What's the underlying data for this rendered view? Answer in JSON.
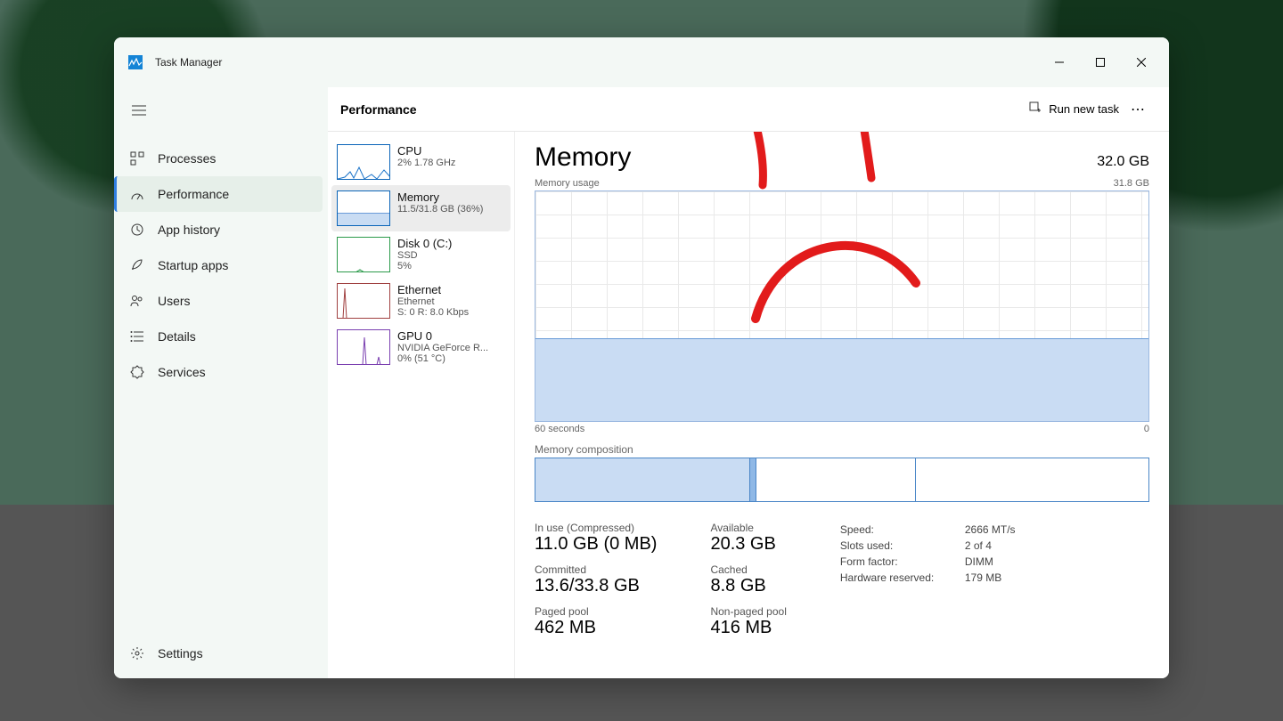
{
  "app": {
    "title": "Task Manager"
  },
  "win_buttons": {
    "min": "min",
    "max": "max",
    "close": "close"
  },
  "sidebar": {
    "items": [
      {
        "id": "processes",
        "label": "Processes"
      },
      {
        "id": "performance",
        "label": "Performance"
      },
      {
        "id": "apphistory",
        "label": "App history"
      },
      {
        "id": "startup",
        "label": "Startup apps"
      },
      {
        "id": "users",
        "label": "Users"
      },
      {
        "id": "details",
        "label": "Details"
      },
      {
        "id": "services",
        "label": "Services"
      }
    ],
    "settings_label": "Settings"
  },
  "header": {
    "title": "Performance",
    "run_task": "Run new task"
  },
  "perf_list": [
    {
      "name": "CPU",
      "sub": "2%  1.78 GHz"
    },
    {
      "name": "Memory",
      "sub": "11.5/31.8 GB (36%)"
    },
    {
      "name": "Disk 0 (C:)",
      "sub": "SSD",
      "sub2": "5%"
    },
    {
      "name": "Ethernet",
      "sub": "Ethernet",
      "sub2": "S: 0 R: 8.0 Kbps"
    },
    {
      "name": "GPU 0",
      "sub": "NVIDIA GeForce R...",
      "sub2": "0%  (51 °C)"
    }
  ],
  "detail": {
    "title": "Memory",
    "total": "32.0 GB",
    "usage_label_left": "Memory usage",
    "usage_label_right": "31.8 GB",
    "axis_left": "60 seconds",
    "axis_right": "0",
    "comp_label": "Memory composition",
    "stats": {
      "inuse_lbl": "In use (Compressed)",
      "inuse_val": "11.0 GB (0 MB)",
      "avail_lbl": "Available",
      "avail_val": "20.3 GB",
      "committed_lbl": "Committed",
      "committed_val": "13.6/33.8 GB",
      "cached_lbl": "Cached",
      "cached_val": "8.8 GB",
      "paged_lbl": "Paged pool",
      "paged_val": "462 MB",
      "nonpaged_lbl": "Non-paged pool",
      "nonpaged_val": "416 MB"
    },
    "kv": {
      "speed_k": "Speed:",
      "speed_v": "2666 MT/s",
      "slots_k": "Slots used:",
      "slots_v": "2 of 4",
      "form_k": "Form factor:",
      "form_v": "DIMM",
      "hw_k": "Hardware reserved:",
      "hw_v": "179 MB"
    }
  },
  "colors": {
    "memory_fill": "#c9dcf3",
    "memory_border": "#6a9bd8",
    "accent": "#2f7de1"
  },
  "chart_data": {
    "type": "area",
    "title": "Memory usage",
    "ylabel": "GB",
    "ylim": [
      0,
      31.8
    ],
    "x_seconds": [
      60,
      0
    ],
    "series": [
      {
        "name": "Memory",
        "approx_constant_value": 11.5,
        "percent": 36
      }
    ],
    "composition_pct": {
      "in_use": 35,
      "modified": 1,
      "standby": 26,
      "free": 38
    }
  }
}
